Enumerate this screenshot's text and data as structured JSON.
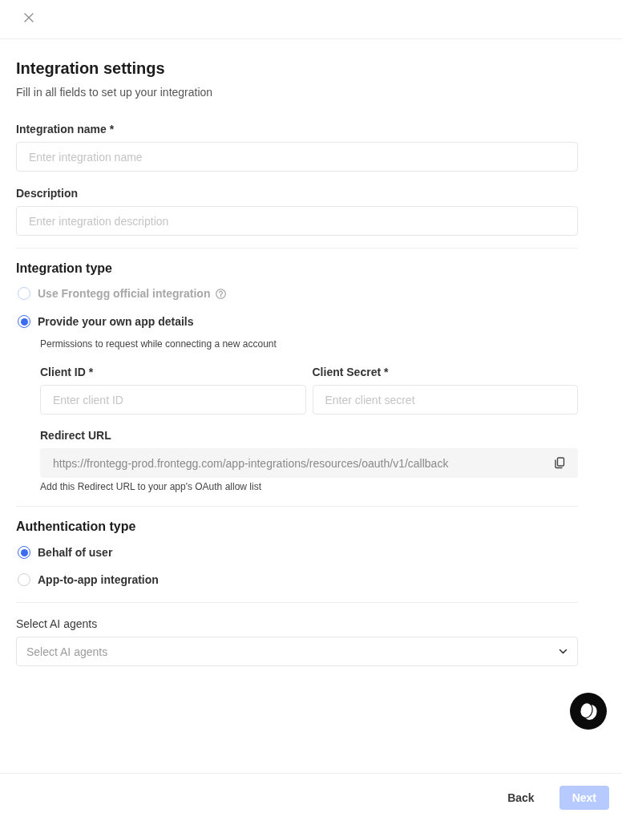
{
  "title": "Integration settings",
  "subtitle": "Fill in all fields to set up your integration",
  "fields": [
    {
      "label": "Integration name *",
      "placeholder": "Enter integration name"
    },
    {
      "label": "Description",
      "placeholder": "Enter integration description"
    }
  ],
  "integration_type": {
    "heading": "Integration type",
    "options": [
      {
        "label": "Use Frontegg official integration",
        "selected": false,
        "disabled": true,
        "has_help": true
      },
      {
        "label": "Provide your own app details",
        "selected": true,
        "disabled": false
      }
    ],
    "details": {
      "description": "Permissions to request while connecting a new account",
      "fields": [
        {
          "label": "Client ID *",
          "placeholder": "Enter client ID"
        },
        {
          "label": "Client Secret *",
          "placeholder": "Enter client secret"
        }
      ],
      "redirect_url": {
        "label": "Redirect URL",
        "value": "https://frontegg-prod.frontegg.com/app-integrations/resources/oauth/v1/callback",
        "hint": "Add this Redirect URL to your app's OAuth allow list"
      }
    }
  },
  "authentication_type": {
    "heading": "Authentication type",
    "options": [
      {
        "label": "Behalf of user",
        "selected": true
      },
      {
        "label": "App-to-app integration",
        "selected": false
      }
    ]
  },
  "ai_agents": {
    "label": "Select AI agents",
    "placeholder": "Select AI agents"
  },
  "footer": {
    "buttons": [
      {
        "label": "Back",
        "kind": "text",
        "disabled": false
      },
      {
        "label": "Next",
        "kind": "primary",
        "disabled": true
      }
    ]
  }
}
